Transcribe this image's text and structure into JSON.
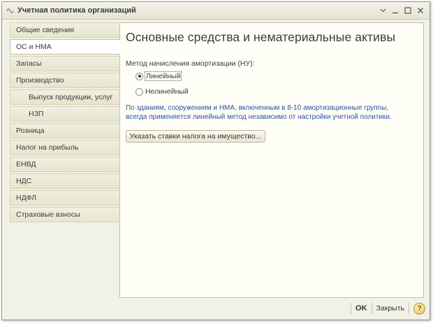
{
  "window": {
    "title": "Учетная политика организаций",
    "controls": {
      "menu": "⌄",
      "minimize": "_",
      "maximize": "□",
      "close": "×"
    }
  },
  "sidebar": {
    "items": [
      {
        "label": "Общие сведения",
        "active": false,
        "sub": false
      },
      {
        "label": "ОС и НМА",
        "active": true,
        "sub": false
      },
      {
        "label": "Запасы",
        "active": false,
        "sub": false
      },
      {
        "label": "Производство",
        "active": false,
        "sub": false
      },
      {
        "label": "Выпуск продукции, услуг",
        "active": false,
        "sub": true
      },
      {
        "label": "НЗП",
        "active": false,
        "sub": true
      },
      {
        "label": "Розница",
        "active": false,
        "sub": false
      },
      {
        "label": "Налог на прибыль",
        "active": false,
        "sub": false
      },
      {
        "label": "ЕНВД",
        "active": false,
        "sub": false
      },
      {
        "label": "НДС",
        "active": false,
        "sub": false
      },
      {
        "label": "НДФЛ",
        "active": false,
        "sub": false
      },
      {
        "label": "Страховые взносы",
        "active": false,
        "sub": false
      }
    ]
  },
  "main": {
    "title": "Основные средства и нематериальные активы",
    "method_label": "Метод начисления амортизации (НУ):",
    "options": [
      {
        "label": "Линейный",
        "checked": true
      },
      {
        "label": "Нелинейный",
        "checked": false
      }
    ],
    "note_line1": "По зданиям, сооружениям и НМА, включенным в 8-10 амортизационные группы,",
    "note_line2": "всегда применяется линейный метод независимо от настройки учетной политики.",
    "rates_button": "Указать ставки налога на имущество..."
  },
  "footer": {
    "ok": "OK",
    "close": "Закрыть",
    "help": "?"
  },
  "colors": {
    "note_text": "#2c4fa3",
    "panel_bg": "#f2f1e6",
    "content_bg": "#fffff8"
  }
}
